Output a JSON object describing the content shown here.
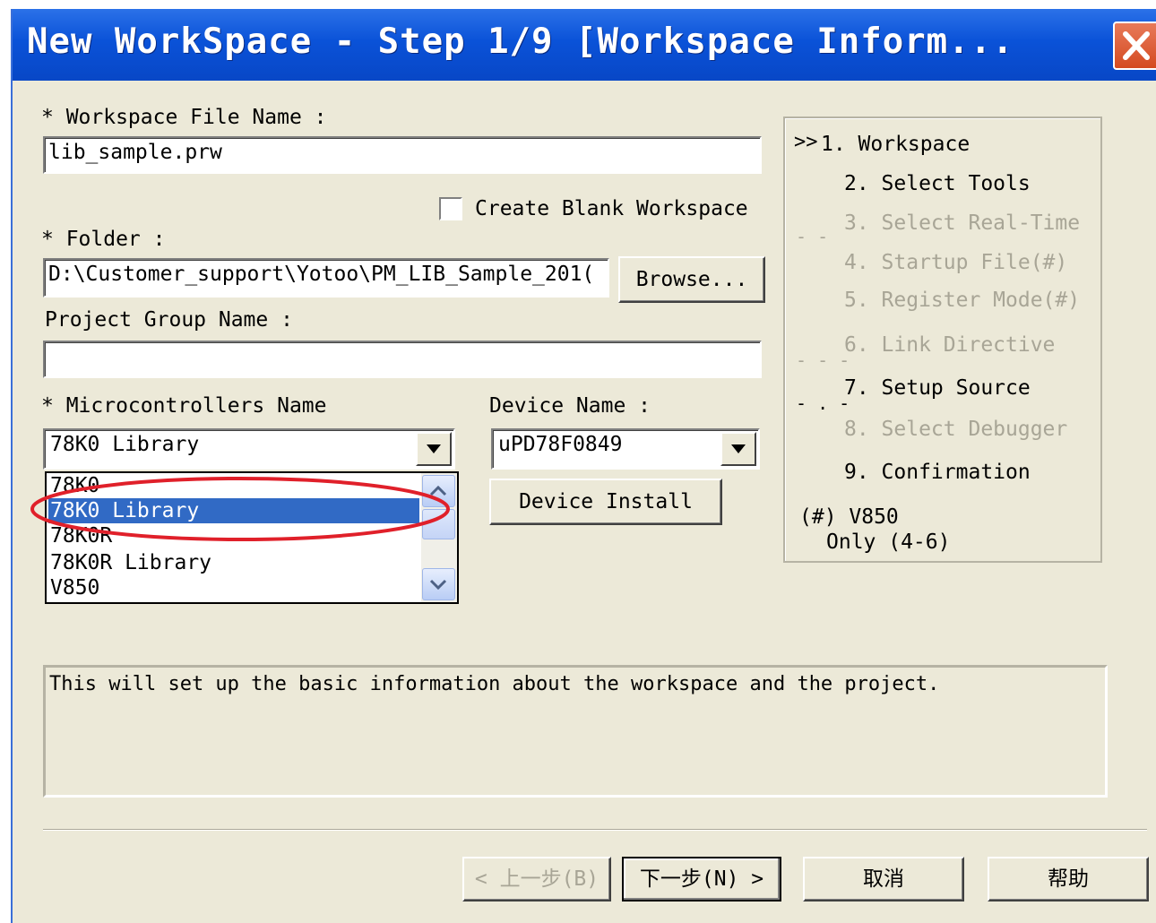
{
  "window": {
    "title": "New WorkSpace - Step 1/9 [Workspace Inform...",
    "close_icon": "close-x-icon"
  },
  "form": {
    "workspace_file_label": "* Workspace File Name :",
    "workspace_file_value": "lib_sample.prw",
    "create_blank_label": "Create Blank Workspace",
    "create_blank_checked": false,
    "folder_label": "* Folder :",
    "folder_value": "D:\\Customer_support\\Yotoo\\PM_LIB_Sample_201(",
    "browse_button": "Browse...",
    "project_group_label": "Project Group Name :",
    "project_group_value": "",
    "micro_label": "* Microcontrollers Name",
    "micro_value": "78K0 Library",
    "micro_options": [
      "78K0",
      "78K0 Library",
      "78K0R",
      "78K0R Library",
      "V850"
    ],
    "micro_selected_index": 1,
    "device_label": "Device Name :",
    "device_value": "uPD78F0849",
    "device_install_button": "Device Install"
  },
  "steps": {
    "marker": ">>",
    "items": [
      {
        "label": "1. Workspace",
        "state": "current"
      },
      {
        "label": "2. Select Tools",
        "state": "enabled"
      },
      {
        "label": "3. Select Real-Time",
        "state": "disabled"
      },
      {
        "label": "4. Startup File(#)",
        "state": "disabled"
      },
      {
        "label": "5. Register Mode(#)",
        "state": "disabled"
      },
      {
        "label": "6. Link Directive",
        "state": "disabled"
      },
      {
        "label": "7. Setup Source",
        "state": "enabled"
      },
      {
        "label": "8. Select Debugger",
        "state": "disabled"
      },
      {
        "label": "9. Confirmation",
        "state": "enabled"
      }
    ],
    "note_line1": "(#) V850",
    "note_line2": "Only (4-6)"
  },
  "description": "This will set up the basic information about the workspace and the project.",
  "buttons": {
    "back": "< 上一步(B)",
    "next": "下一步(N) >",
    "cancel": "取消",
    "help": "帮助"
  },
  "colors": {
    "titlebar": "#0a52d8",
    "dialog_bg": "#ece9d8",
    "selection": "#316ac5",
    "annotation": "#e0202a"
  }
}
